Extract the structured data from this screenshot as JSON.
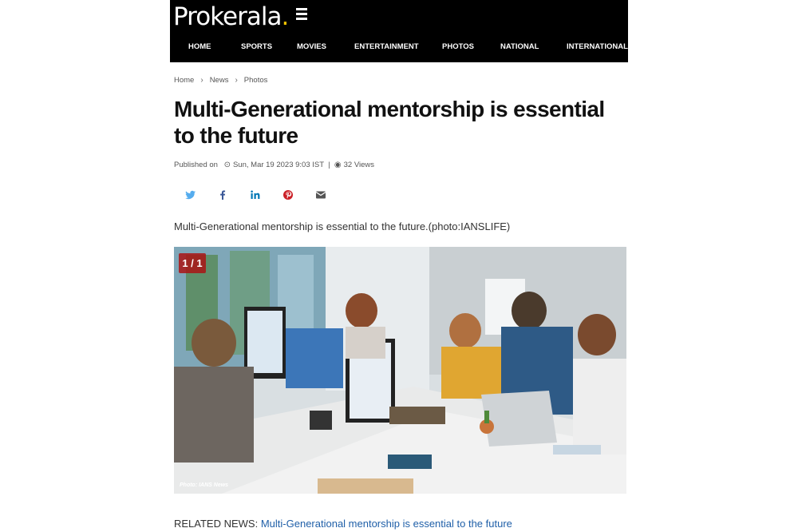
{
  "header": {
    "logo_text": "Prokerala",
    "logo_dot": ".",
    "nav": [
      "HOME",
      "SPORTS",
      "MOVIES",
      "ENTERTAINMENT",
      "PHOTOS",
      "NATIONAL",
      "INTERNATIONAL"
    ]
  },
  "breadcrumb": [
    "Home",
    "News",
    "Photos"
  ],
  "article": {
    "title": "Multi-Generational mentorship is essential to the future",
    "published_label": "Published on",
    "published_date": "Sun, Mar 19 2023 9:03 IST",
    "views": "32 Views",
    "caption": "Multi-Generational mentorship is essential to the future.(photo:IANSLIFE)",
    "photo_counter": "1 / 1",
    "photo_credit": "Photo: IANS News"
  },
  "share_icons": [
    "twitter-icon",
    "facebook-icon",
    "linkedin-icon",
    "pinterest-icon",
    "email-icon"
  ],
  "related": {
    "label": "RELATED NEWS:",
    "link_text": "Multi-Generational mentorship is essential to the future"
  },
  "colors": {
    "header_bg": "#000000",
    "logo_accent": "#f2c200",
    "link": "#1f5fa8",
    "twitter": "#55acee",
    "facebook": "#3b5998",
    "linkedin": "#0077b5",
    "pinterest": "#cb2027",
    "email": "#555555"
  }
}
